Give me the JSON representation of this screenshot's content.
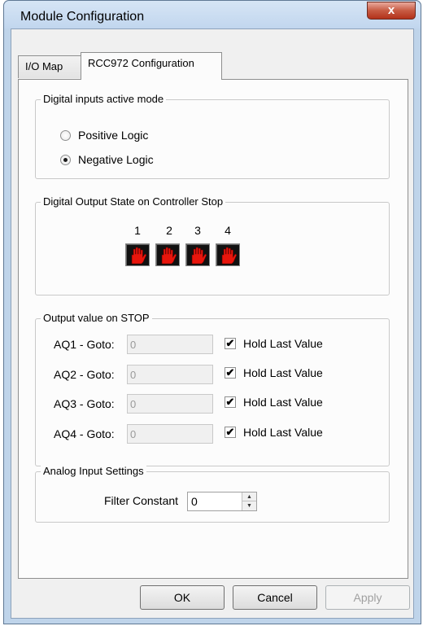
{
  "window": {
    "title": "Module Configuration",
    "close_glyph": "x"
  },
  "tabs": [
    {
      "label": "I/O Map",
      "active": false
    },
    {
      "label": "RCC972 Configuration",
      "active": true
    }
  ],
  "digital_inputs": {
    "legend": "Digital inputs active mode",
    "options": [
      {
        "label": "Positive Logic",
        "checked": false
      },
      {
        "label": "Negative Logic",
        "checked": true
      }
    ]
  },
  "digital_output": {
    "legend": "Digital Output State on Controller Stop",
    "channels": [
      "1",
      "2",
      "3",
      "4"
    ],
    "icon": "red-stop-hand-icon",
    "icon_color": "#e8150c"
  },
  "output_on_stop": {
    "legend": "Output value on STOP",
    "rows": [
      {
        "label": "AQ1 - Goto:",
        "value": "0",
        "hold_label": "Hold Last Value",
        "hold_checked": true
      },
      {
        "label": "AQ2 - Goto:",
        "value": "0",
        "hold_label": "Hold Last Value",
        "hold_checked": true
      },
      {
        "label": "AQ3 - Goto:",
        "value": "0",
        "hold_label": "Hold Last Value",
        "hold_checked": true
      },
      {
        "label": "AQ4 - Goto:",
        "value": "0",
        "hold_label": "Hold Last Value",
        "hold_checked": true
      }
    ]
  },
  "analog_input": {
    "legend": "Analog Input Settings",
    "filter_label": "Filter Constant",
    "filter_value": "0"
  },
  "buttons": {
    "ok": "OK",
    "cancel": "Cancel",
    "apply": "Apply"
  },
  "colors": {
    "titlebar": "#c9dbef",
    "close_button": "#c75b43",
    "panel": "#fcfcfc"
  }
}
